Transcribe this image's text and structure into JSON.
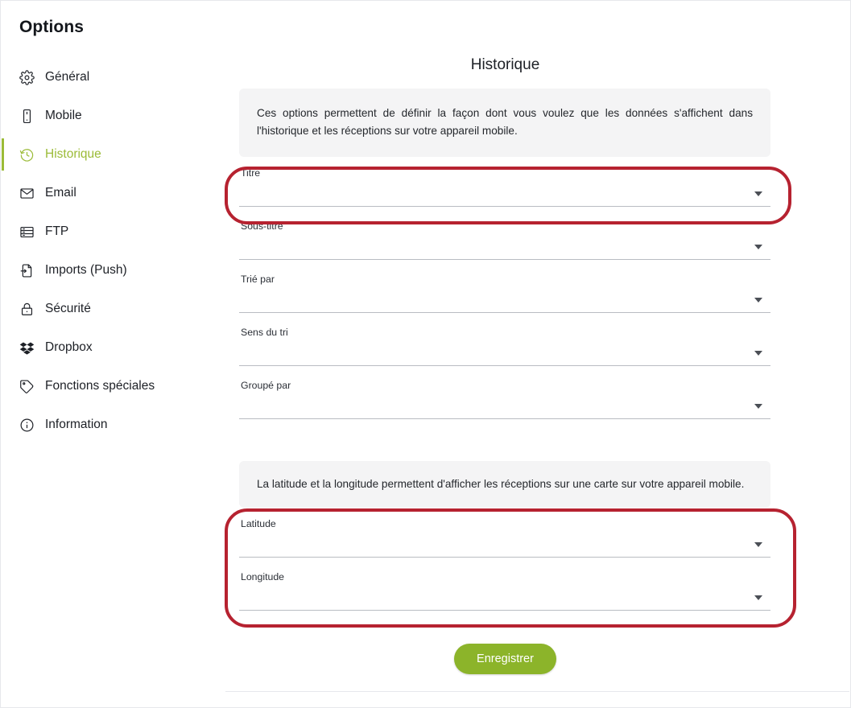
{
  "app": {
    "title": "Options"
  },
  "sidebar": {
    "items": [
      {
        "label": "Général",
        "icon": "gear-icon",
        "active": false
      },
      {
        "label": "Mobile",
        "icon": "mobile-icon",
        "active": false
      },
      {
        "label": "Historique",
        "icon": "history-icon",
        "active": true
      },
      {
        "label": "Email",
        "icon": "envelope-icon",
        "active": false
      },
      {
        "label": "FTP",
        "icon": "server-icon",
        "active": false
      },
      {
        "label": "Imports (Push)",
        "icon": "import-icon",
        "active": false
      },
      {
        "label": "Sécurité",
        "icon": "lock-icon",
        "active": false
      },
      {
        "label": "Dropbox",
        "icon": "dropbox-icon",
        "active": false
      },
      {
        "label": "Fonctions spéciales",
        "icon": "tag-icon",
        "active": false
      },
      {
        "label": "Information",
        "icon": "info-icon",
        "active": false
      }
    ]
  },
  "main": {
    "title": "Historique",
    "info_top": "Ces options permettent de définir la façon dont vous voulez que les données s'affichent dans l'historique et les réceptions sur votre appareil mobile.",
    "info_map": "La latitude et la longitude permettent d'afficher les réceptions sur une carte sur votre appareil mobile.",
    "fields": [
      {
        "label": "Titre",
        "value": "",
        "caret": "chevron-down-icon"
      },
      {
        "label": "Sous-titre",
        "value": "",
        "caret": "chevron-down-icon"
      },
      {
        "label": "Trié par",
        "value": "",
        "caret": "chevron-down-icon"
      },
      {
        "label": "Sens du tri",
        "value": "",
        "caret": "chevron-down-icon"
      },
      {
        "label": "Groupé par",
        "value": "",
        "caret": "chevron-down-icon"
      }
    ],
    "geo_fields": [
      {
        "label": "Latitude",
        "value": "",
        "caret": "chevron-down-icon"
      },
      {
        "label": "Longitude",
        "value": "",
        "caret": "chevron-down-icon"
      }
    ],
    "save_label": "Enregistrer"
  },
  "annotations": [
    {
      "name": "highlight-titre",
      "color": "#b62230"
    },
    {
      "name": "highlight-lat-long",
      "color": "#b62230"
    }
  ],
  "colors": {
    "accent_green": "#9bbb37",
    "button_green": "#8cb42a",
    "annotation_red": "#b62230",
    "info_background": "#f4f4f5",
    "text": "#1d2026"
  }
}
